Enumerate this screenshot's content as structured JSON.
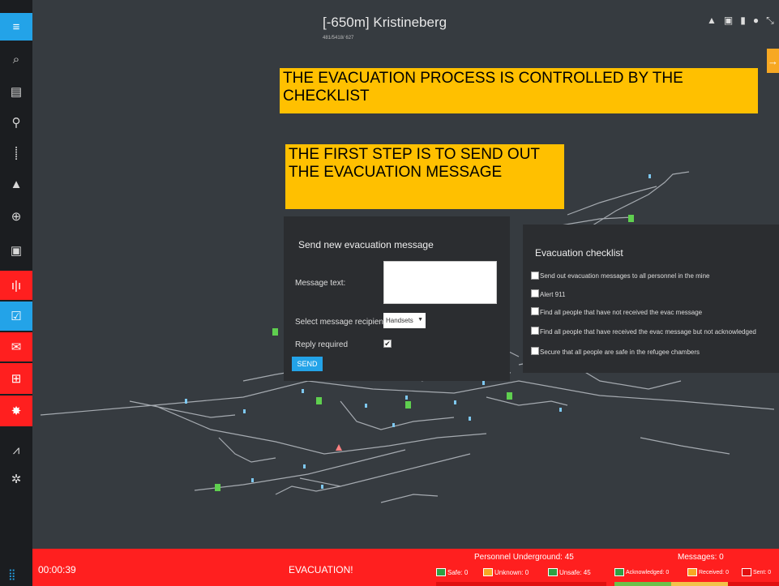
{
  "header": {
    "title": "[-650m] Kristineberg",
    "subtitle": "481/5418/ 627"
  },
  "sidebar": {
    "items": [
      {
        "icon": "menu-icon",
        "glyph": "≡"
      },
      {
        "icon": "search-icon",
        "glyph": "⌕"
      },
      {
        "icon": "document-icon",
        "glyph": "▤"
      },
      {
        "icon": "location-pin-icon",
        "glyph": "⚲"
      },
      {
        "icon": "route-icon",
        "glyph": "⸽"
      },
      {
        "icon": "warning-icon",
        "glyph": "▲"
      },
      {
        "icon": "globe-icon",
        "glyph": "⊕"
      },
      {
        "icon": "map-image-icon",
        "glyph": "▣"
      },
      {
        "icon": "alarm-signal-icon",
        "glyph": "ı|ı"
      },
      {
        "icon": "checklist-icon",
        "glyph": "☑"
      },
      {
        "icon": "mail-icon",
        "glyph": "✉"
      },
      {
        "icon": "emergency-icon",
        "glyph": "⊞"
      },
      {
        "icon": "people-alert-icon",
        "glyph": "✸"
      },
      {
        "icon": "statistics-icon",
        "glyph": "⩘"
      },
      {
        "icon": "settings-icon",
        "glyph": "✲"
      }
    ]
  },
  "annotations": {
    "note1": "THE EVACUATION PROCESS IS CONTROLLED BY THE CHECKLIST",
    "note2": "THE FIRST STEP IS TO SEND OUT THE EVACUATION MESSAGE"
  },
  "evac_form": {
    "title": "Send new evacuation message",
    "message_label": "Message text:",
    "message_value": "",
    "recipients_label": "Select message recipients:",
    "recipients_value": "Handsets",
    "reply_label": "Reply required",
    "reply_checked": true,
    "send_label": "SEND"
  },
  "checklist": {
    "title": "Evacuation checklist",
    "items": [
      {
        "label": "Send out evacuation messages to all personnel in the mine",
        "checked": false
      },
      {
        "label": "Alert 911",
        "checked": false
      },
      {
        "label": "Find all people that have not received the evac message",
        "checked": false
      },
      {
        "label": "Find all people that have received the evac message but not acknowledged",
        "checked": false
      },
      {
        "label": "Secure that all people are safe in the refugee chambers",
        "checked": false
      }
    ]
  },
  "status_bar": {
    "timer": "00:00:39",
    "mode": "EVACUATION!",
    "personnel_label": "Personnel Underground: 45",
    "safe": "Safe: 0",
    "unknown": "Unknown: 0",
    "unsafe": "Unsafe: 45",
    "messages_label": "Messages: 0",
    "acknowledged": "Acknowledged: 0",
    "received": "Received: 0",
    "sent": "Sent: 0"
  },
  "colors": {
    "accent": "#23a3e8",
    "alert": "#ff1f1f",
    "note": "#ffc000",
    "safe": "#2ea043",
    "warn": "#f7a823"
  }
}
